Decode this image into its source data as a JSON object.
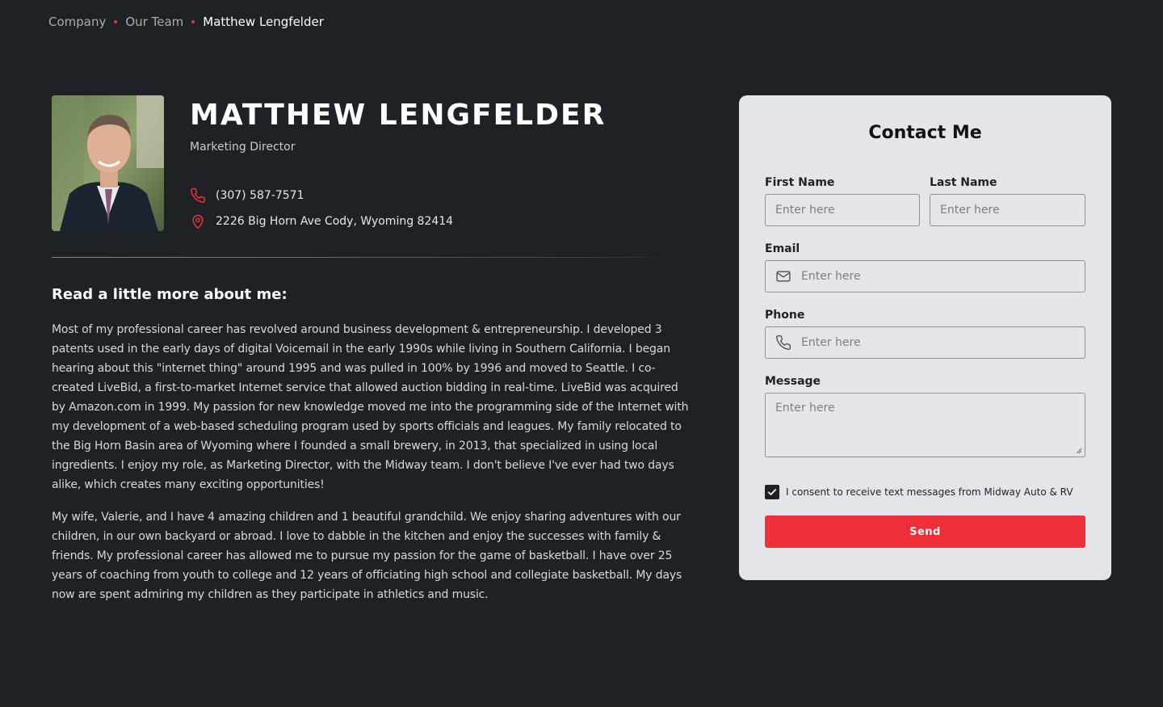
{
  "breadcrumb": {
    "items": [
      "Company",
      "Our Team",
      "Matthew Lengfelder"
    ]
  },
  "profile": {
    "name": "MATTHEW LENGFELDER",
    "title": "Marketing Director",
    "phone": "(307) 587-7571",
    "address": "2226 Big Horn Ave Cody, Wyoming 82414"
  },
  "about": {
    "heading": "Read a little more about me:",
    "paragraphs": [
      "Most of my professional career has revolved around business development & entrepreneurship. I developed 3 patents used in the early days of digital Voicemail in the early 1990s while living in Southern California. I began hearing about this \"internet thing\" around 1995 and was pulled in 100% by 1996 and moved to Seattle. I co-created LiveBid, a first-to-market Internet service that allowed auction bidding in real-time. LiveBid was acquired by Amazon.com in 1999. My passion for new knowledge moved me into the programming side of the Internet with my development of a web-based scheduling program used by sports officials and leagues. My family relocated to the Big Horn Basin area of Wyoming where I founded a small brewery, in 2013, that specialized in using local ingredients. I enjoy my role, as Marketing Director, with the Midway team. I don't believe I've ever had two days alike, which creates many exciting opportunities!",
      "My wife, Valerie, and I have 4 amazing children and 1 beautiful grandchild. We enjoy sharing adventures with our children, in our own backyard or abroad. I love to dabble in the kitchen and enjoy the successes with family & friends. My professional career has allowed me to pursue my passion for the game of basketball. I have over 25 years of coaching from youth to college and 12 years of officiating high school and collegiate basketball. My days now are spent admiring my children as they participate in athletics and music."
    ]
  },
  "contact_form": {
    "title": "Contact Me",
    "first_name_label": "First Name",
    "last_name_label": "Last Name",
    "email_label": "Email",
    "phone_label": "Phone",
    "message_label": "Message",
    "placeholder": "Enter here",
    "consent_text": "I consent to receive text messages from Midway Auto & RV",
    "consent_checked": true,
    "send_label": "Send"
  },
  "colors": {
    "background": "#1e2126",
    "accent": "#ee2f38",
    "card": "#e4e5e8"
  },
  "icons": [
    "phone-icon",
    "location-pin-icon",
    "mail-icon",
    "check-icon"
  ]
}
